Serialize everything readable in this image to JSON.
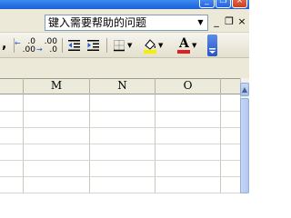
{
  "window": {
    "minimize_glyph": "_",
    "restore_glyph": "❐",
    "close_glyph": "×"
  },
  "menubar": {
    "help_box": {
      "text": "键入需要帮助的问题",
      "dropdown_glyph": "▼"
    },
    "mdi_minimize": "_",
    "mdi_restore": "❐",
    "mdi_close": "×"
  },
  "toolbar": {
    "comma_style": ",",
    "increase_decimal": [
      ".0",
      ".00"
    ],
    "decrease_decimal": [
      ".00",
      ".0"
    ],
    "icons": [
      "comma-style-icon",
      "increase-decimal-icon",
      "decrease-decimal-icon",
      "decrease-indent-icon",
      "increase-indent-icon",
      "borders-icon",
      "fill-color-icon",
      "font-color-icon",
      "toolbar-options-icon"
    ],
    "font_color_letter": "A",
    "fill_color": "#f2f200",
    "font_color": "#e02020"
  },
  "sheet": {
    "columns": [
      "M",
      "N",
      "O"
    ]
  },
  "scrollbar": {
    "up_glyph": "▲"
  }
}
